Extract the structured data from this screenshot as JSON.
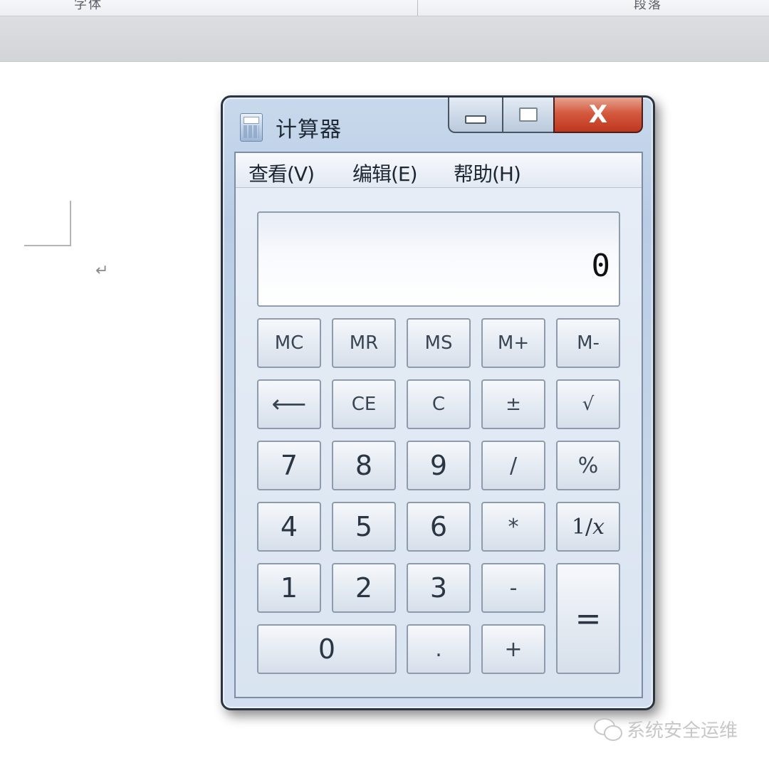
{
  "document": {
    "ribbon_group_left": "字体",
    "ribbon_group_right": "段落",
    "paragraph_mark": "↵"
  },
  "window": {
    "title": "计算器",
    "icon": "calculator-icon",
    "close_label": "X"
  },
  "menu": {
    "items": [
      "查看(V)",
      "编辑(E)",
      "帮助(H)"
    ]
  },
  "display": {
    "value": "0"
  },
  "keys": {
    "mc": "MC",
    "mr": "MR",
    "ms": "MS",
    "mplus": "M+",
    "mminus": "M-",
    "backspace": "⟵",
    "ce": "CE",
    "c": "C",
    "plusminus": "±",
    "sqrt": "√",
    "seven": "7",
    "eight": "8",
    "nine": "9",
    "divide": "/",
    "percent": "%",
    "four": "4",
    "five": "5",
    "six": "6",
    "multiply": "*",
    "reciprocal_num": "1/",
    "reciprocal_var": "x",
    "one": "1",
    "two": "2",
    "three": "3",
    "minus": "-",
    "equals": "=",
    "zero": "0",
    "decimal": ".",
    "plus": "+"
  },
  "watermark": {
    "text": "系统安全运维",
    "icon": "wechat-icon"
  },
  "colors": {
    "close_button": "#c9452b",
    "frame": "#b8cde5"
  }
}
